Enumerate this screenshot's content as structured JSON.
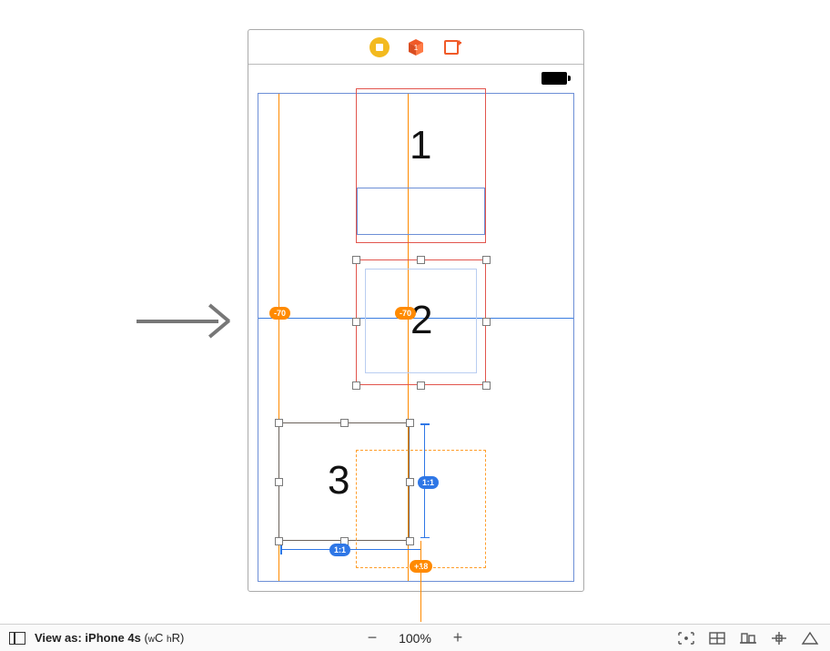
{
  "toolbar": {
    "stop_icon": "stop-circle",
    "cube_icon": "3d-cube",
    "add_icon": "add-view"
  },
  "views": {
    "label_1": "1",
    "label_2": "2",
    "label_3": "3"
  },
  "constraints": {
    "offset_minus70_a": "-70",
    "offset_minus70_b": "-70",
    "ratio_1_1_a": "1:1",
    "ratio_1_1_b": "1:1",
    "offset_plus18": "+18"
  },
  "bottom": {
    "view_as_prefix": "View as: ",
    "device": "iPhone 4s",
    "size_class_open": " (",
    "size_w_prefix": "w",
    "size_w": "C ",
    "size_h_prefix": "h",
    "size_h": "R",
    "size_class_close": ")",
    "zoom": "100%"
  }
}
